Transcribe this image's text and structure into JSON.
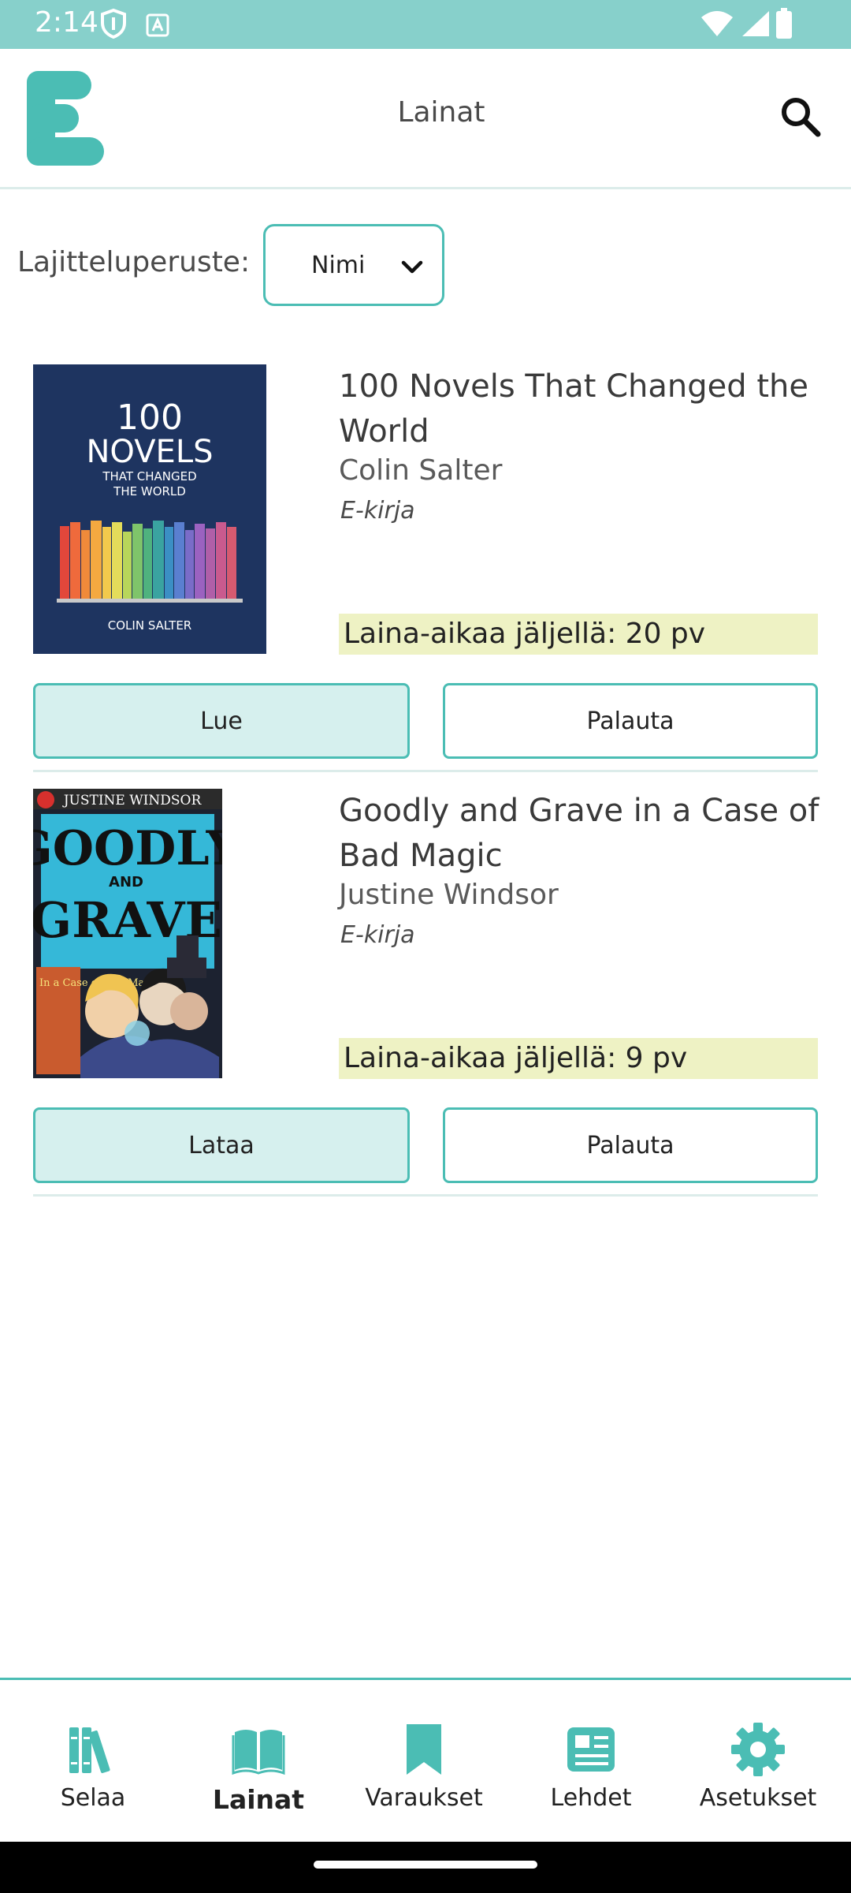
{
  "status_bar": {
    "time": "2:14"
  },
  "header": {
    "title": "Lainat"
  },
  "sort": {
    "label": "Lajitteluperuste:",
    "selected": "Nimi"
  },
  "loans": [
    {
      "title": "100 Novels That Changed the World",
      "author": "Colin Salter",
      "format": "E-kirja",
      "due": "Laina-aikaa jäljellä: 20 pv",
      "primary_action": "Lue",
      "secondary_action": "Palauta",
      "cover": {
        "line1": "100",
        "line2": "NOVELS",
        "line3": "THAT CHANGED",
        "line4": "THE WORLD",
        "author": "COLIN SALTER"
      }
    },
    {
      "title": "Goodly and Grave in a Case of Bad Magic",
      "author": "Justine Windsor",
      "format": "E-kirja",
      "due": "Laina-aikaa jäljellä: 9 pv",
      "primary_action": "Lataa",
      "secondary_action": "Palauta",
      "cover": {
        "author": "JUSTINE WINDSOR",
        "word1": "GOODLY",
        "word2": "AND",
        "word3": "GRAVE",
        "subtitle": "In a Case of Bad Magic"
      }
    }
  ],
  "bottom_nav": [
    {
      "label": "Selaa",
      "icon": "books-icon",
      "active": false
    },
    {
      "label": "Lainat",
      "icon": "open-book-icon",
      "active": true
    },
    {
      "label": "Varaukset",
      "icon": "bookmark-icon",
      "active": false
    },
    {
      "label": "Lehdet",
      "icon": "newspaper-icon",
      "active": false
    },
    {
      "label": "Asetukset",
      "icon": "gear-icon",
      "active": false
    }
  ],
  "colors": {
    "accent": "#4bbdb4",
    "status_bar": "#87d0cb",
    "due_bg": "#eef2c4",
    "primary_btn_bg": "#d6f0ee"
  }
}
